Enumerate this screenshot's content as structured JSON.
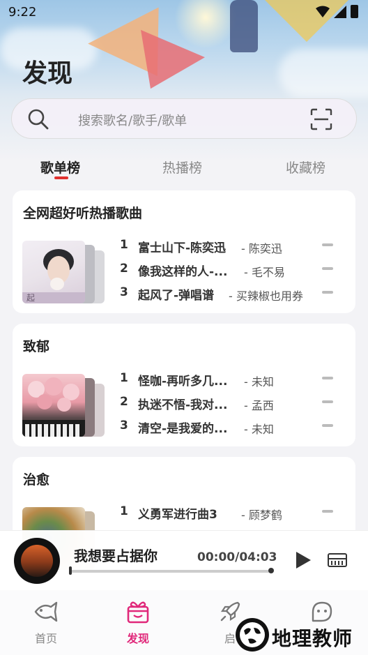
{
  "status": {
    "time": "9:22"
  },
  "page": {
    "title": "发现"
  },
  "search": {
    "placeholder": "搜索歌名/歌手/歌单"
  },
  "tabs": [
    {
      "label": "歌单榜",
      "active": true
    },
    {
      "label": "热播榜",
      "active": false
    },
    {
      "label": "收藏榜",
      "active": false
    }
  ],
  "cards": [
    {
      "title": "全网超好听热播歌曲",
      "songs": [
        {
          "num": "1",
          "name": "富士山下-陈奕迅",
          "artist": "陈奕迅"
        },
        {
          "num": "2",
          "name": "像我这样的人-...",
          "artist": "毛不易"
        },
        {
          "num": "3",
          "name": "起风了-弹唱谱",
          "artist": "买辣椒也用券"
        }
      ]
    },
    {
      "title": "致郁",
      "songs": [
        {
          "num": "1",
          "name": "怪咖-再听多几...",
          "artist": "未知"
        },
        {
          "num": "2",
          "name": "执迷不悟-我对...",
          "artist": "孟西"
        },
        {
          "num": "3",
          "name": "清空-是我爱的...",
          "artist": "未知"
        }
      ]
    },
    {
      "title": "治愈",
      "songs": [
        {
          "num": "1",
          "name": "义勇军进行曲3",
          "artist": "顾梦鹤"
        }
      ]
    }
  ],
  "player": {
    "title": "我想要占据你",
    "time": "00:00/04:03"
  },
  "nav": [
    {
      "label": "首页",
      "icon": "fish-icon"
    },
    {
      "label": "发现",
      "icon": "gift-box-icon",
      "active": true
    },
    {
      "label": "启",
      "icon": "rocket-icon"
    },
    {
      "label": "",
      "icon": "smiley-face-icon"
    }
  ],
  "watermark": {
    "text": "地理教师"
  },
  "colors": {
    "accent": "#e0287a",
    "indicator": "#e0312f"
  }
}
